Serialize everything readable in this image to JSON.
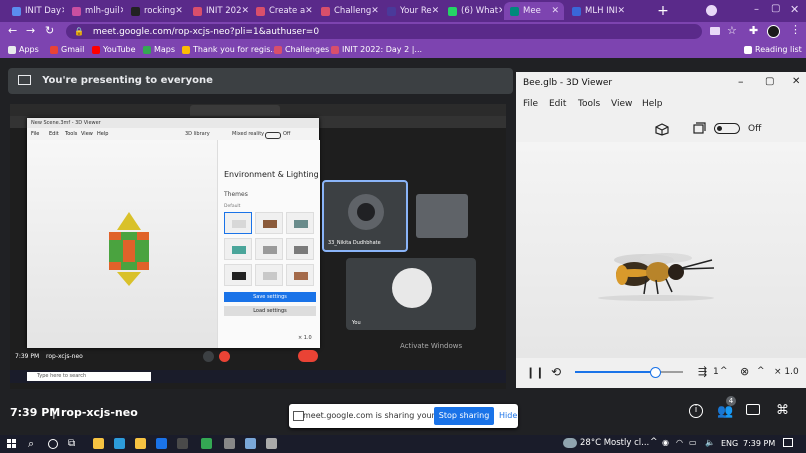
{
  "tabs": [
    {
      "label": "INIT Day",
      "color": "#5b8def"
    },
    {
      "label": "mlh-guil",
      "color": "#c94fa0"
    },
    {
      "label": "rocking",
      "color": "#222222"
    },
    {
      "label": "INIT 202",
      "color": "#d94f6b"
    },
    {
      "label": "Create a",
      "color": "#d94f6b"
    },
    {
      "label": "Challeng",
      "color": "#d94f6b"
    },
    {
      "label": "Your Re",
      "color": "#4a3a9a"
    },
    {
      "label": "(6) What",
      "color": "#25d366"
    },
    {
      "label": "Mee",
      "color": "#00897b"
    },
    {
      "label": "MLH INI",
      "color": "#3a67d8"
    }
  ],
  "address": "meet.google.com/rop-xcjs-neo?pli=1&authuser=0",
  "bookmarks": [
    {
      "label": "Apps",
      "color": "#e8eaed"
    },
    {
      "label": "Gmail",
      "color": "#ea4335"
    },
    {
      "label": "YouTube",
      "color": "#ff0000"
    },
    {
      "label": "Maps",
      "color": "#34a853"
    },
    {
      "label": "Thank you for regis...",
      "color": "#fbbc04"
    },
    {
      "label": "Challenges",
      "color": "#d94f6b"
    },
    {
      "label": "INIT 2022: Day 2 |...",
      "color": "#d94f6b"
    }
  ],
  "reading_list": "Reading list",
  "presenting_banner": "You're presenting to everyone",
  "viewer": {
    "title": "Bee.glb - 3D Viewer",
    "menu": [
      "File",
      "Edit",
      "Tools",
      "View",
      "Help"
    ],
    "toggle_label": "Off",
    "counter": "1",
    "zoom": "× 1.0",
    "progress": 0.73
  },
  "shared_screen": {
    "inner_viewer_title": "New Scene.3mf - 3D Viewer",
    "inner_menu": [
      "File",
      "Edit",
      "Tools",
      "View",
      "Help"
    ],
    "panel_title": "Environment & Lighting",
    "themes_label": "Themes",
    "default_label": "Default",
    "save_settings": "Save settings",
    "load_settings": "Load settings",
    "participant_name": "33_Nikita Dudhbhate",
    "you_label": "You",
    "time_small": "7:39 PM",
    "meeting_small": "rop-xcjs-neo",
    "activate_windows": "Activate Windows",
    "search_placeholder": "Type here to search",
    "mixed_reality": "Mixed reality",
    "off_small": "Off",
    "zoom_small": "× 1.0"
  },
  "meet_bar": {
    "time": "7:39 PM",
    "meeting_code": "rop-xcjs-neo",
    "sharing_text": "meet.google.com is sharing your screen.",
    "stop_sharing": "Stop sharing",
    "hide": "Hide",
    "people_count": "4"
  },
  "taskbar": {
    "weather": "28°C  Mostly cl...",
    "language": "ENG",
    "time": "7:39 PM"
  },
  "colors": {
    "chrome_dark": "#5a2a8a",
    "chrome_light": "#7d44b0",
    "meet_bg": "#202124",
    "accent_blue": "#1a73e8"
  }
}
